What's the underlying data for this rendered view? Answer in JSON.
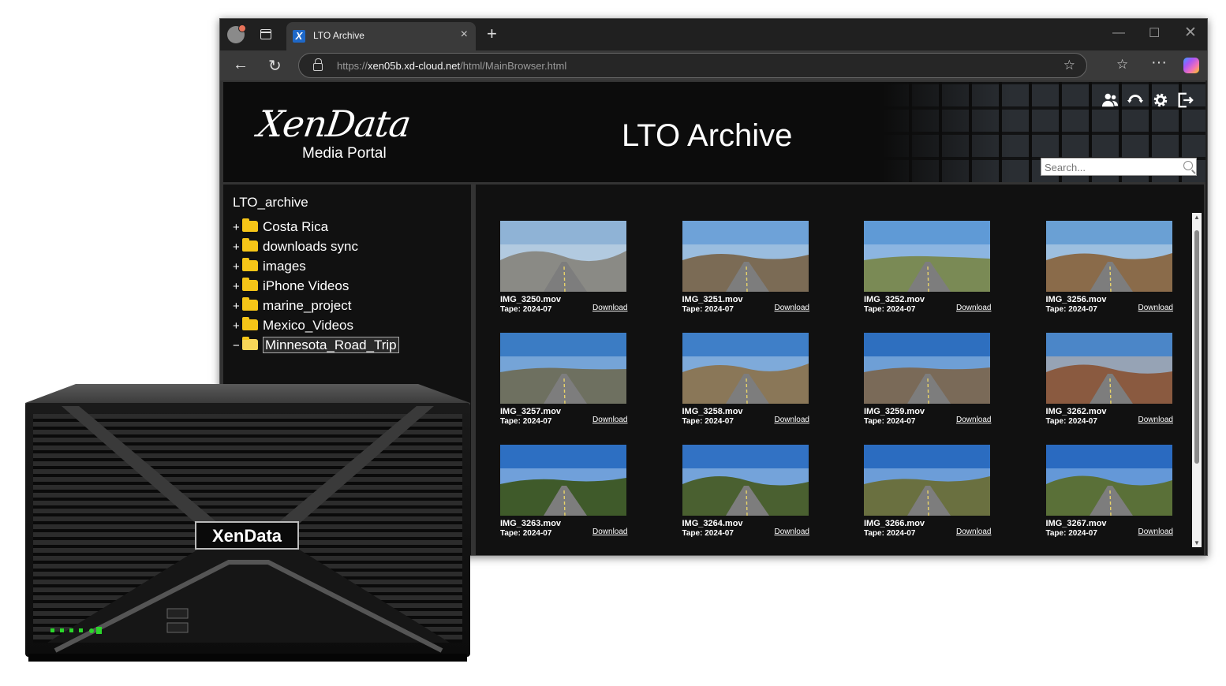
{
  "browser": {
    "tab_title": "LTO Archive",
    "tab_favicon": "X",
    "url_prefix": "https://",
    "url_host": "xen05b.xd-cloud.net",
    "url_path": "/html/MainBrowser.html"
  },
  "portal": {
    "logo_main": "XenData",
    "logo_sub": "Media Portal",
    "title": "LTO Archive",
    "header_icons": [
      "users-icon",
      "refresh-icon",
      "settings-icon",
      "logout-icon"
    ],
    "search_placeholder": "Search..."
  },
  "tree": {
    "root": "LTO_archive",
    "items": [
      {
        "toggle": "+",
        "label": "Costa Rica"
      },
      {
        "toggle": "+",
        "label": "downloads sync"
      },
      {
        "toggle": "+",
        "label": "images"
      },
      {
        "toggle": "+",
        "label": "iPhone Videos"
      },
      {
        "toggle": "+",
        "label": "marine_project"
      },
      {
        "toggle": "+",
        "label": "Mexico_Videos"
      },
      {
        "toggle": "−",
        "label": "Minnesota_Road_Trip",
        "selected": true
      }
    ]
  },
  "files": [
    {
      "name": "IMG_3250.mov",
      "tape": "Tape: 2024-07",
      "download": "Download"
    },
    {
      "name": "IMG_3251.mov",
      "tape": "Tape: 2024-07",
      "download": "Download"
    },
    {
      "name": "IMG_3252.mov",
      "tape": "Tape: 2024-07",
      "download": "Download"
    },
    {
      "name": "IMG_3256.mov",
      "tape": "Tape: 2024-07",
      "download": "Download"
    },
    {
      "name": "IMG_3257.mov",
      "tape": "Tape: 2024-07",
      "download": "Download"
    },
    {
      "name": "IMG_3258.mov",
      "tape": "Tape: 2024-07",
      "download": "Download"
    },
    {
      "name": "IMG_3259.mov",
      "tape": "Tape: 2024-07",
      "download": "Download"
    },
    {
      "name": "IMG_3262.mov",
      "tape": "Tape: 2024-07",
      "download": "Download"
    },
    {
      "name": "IMG_3263.mov",
      "tape": "Tape: 2024-07",
      "download": "Download"
    },
    {
      "name": "IMG_3264.mov",
      "tape": "Tape: 2024-07",
      "download": "Download"
    },
    {
      "name": "IMG_3266.mov",
      "tape": "Tape: 2024-07",
      "download": "Download"
    },
    {
      "name": "IMG_3267.mov",
      "tape": "Tape: 2024-07",
      "download": "Download"
    }
  ],
  "appliance": {
    "badge": "XenData"
  }
}
